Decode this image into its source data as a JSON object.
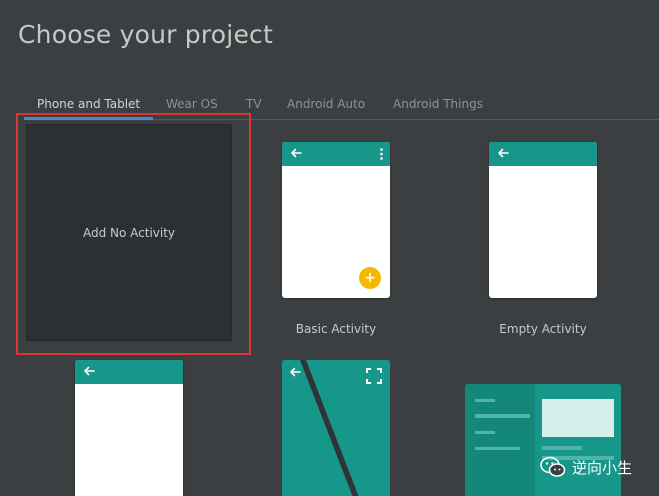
{
  "header": {
    "title": "Choose your project"
  },
  "tabs": [
    {
      "label": "Phone and Tablet",
      "active": true
    },
    {
      "label": "Wear OS",
      "active": false
    },
    {
      "label": "TV",
      "active": false
    },
    {
      "label": "Android Auto",
      "active": false
    },
    {
      "label": "Android Things",
      "active": false
    }
  ],
  "templates": {
    "no_activity": {
      "label": "Add No Activity",
      "selected": true
    },
    "basic": {
      "label": "Basic Activity",
      "fab_symbol": "+"
    },
    "empty": {
      "label": "Empty Activity"
    }
  },
  "watermark": {
    "text": "逆向小生"
  },
  "colors": {
    "background": "#3c3f41",
    "accent_teal": "#16978a",
    "tab_underline": "#4a88c7",
    "selection_highlight": "#d93636",
    "fab": "#f5b800"
  },
  "icons": [
    "back-arrow-icon",
    "overflow-menu-icon",
    "fullscreen-icon",
    "wechat-icon"
  ]
}
